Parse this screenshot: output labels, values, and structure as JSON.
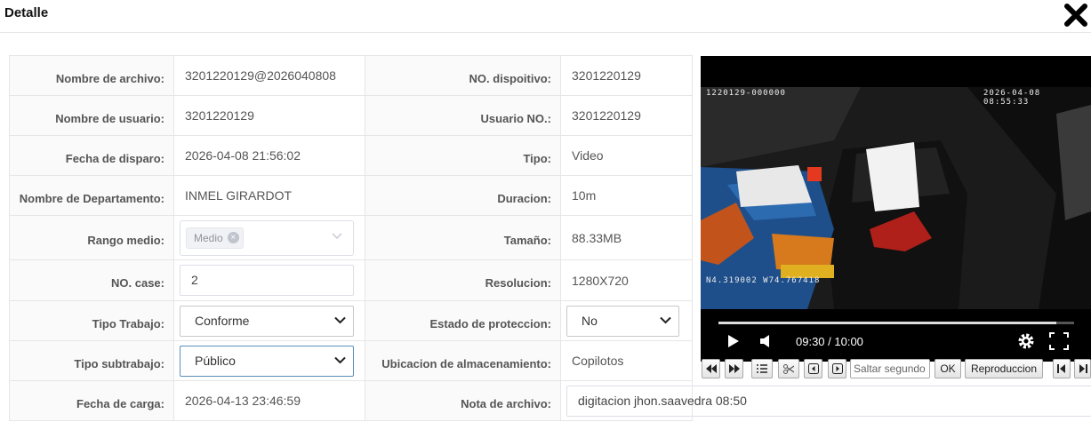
{
  "header": {
    "title": "Detalle"
  },
  "fields": {
    "nombre_archivo": {
      "label": "Nombre de archivo:",
      "value": "3201220129@2026040808"
    },
    "nombre_usuario": {
      "label": "Nombre de usuario:",
      "value": "3201220129"
    },
    "fecha_disparo": {
      "label": "Fecha de disparo:",
      "value": "2026-04-08 21:56:02"
    },
    "departamento": {
      "label": "Nombre de Departamento:",
      "value": "INMEL GIRARDOT"
    },
    "rango_medio": {
      "label": "Rango medio:",
      "value": "Medio"
    },
    "no_case": {
      "label": "NO. case:",
      "value": "2"
    },
    "tipo_trabajo": {
      "label": "Tipo Trabajo:",
      "value": "Conforme"
    },
    "tipo_subtrabajo": {
      "label": "Tipo subtrabajo:",
      "value": "Público"
    },
    "fecha_carga": {
      "label": "Fecha de carga:",
      "value": "2026-04-13 23:46:59"
    },
    "no_dispositivo": {
      "label": "NO. dispoitivo:",
      "value": "3201220129"
    },
    "usuario_no": {
      "label": "Usuario NO.:",
      "value": "3201220129"
    },
    "tipo": {
      "label": "Tipo:",
      "value": "Video"
    },
    "duracion": {
      "label": "Duracion:",
      "value": "10m"
    },
    "tamano": {
      "label": "Tamaño:",
      "value": "88.33MB"
    },
    "resolucion": {
      "label": "Resolucion:",
      "value": "1280X720"
    },
    "estado_proteccion": {
      "label": "Estado de proteccion:",
      "value": "No"
    },
    "ubicacion": {
      "label": "Ubicacion de almacenamiento:",
      "value": "Copilotos"
    },
    "nota_archivo": {
      "label": "Nota de archivo:",
      "value": "digitacion jhon.saavedra 08:50"
    }
  },
  "video": {
    "osd_top_left": "1220129-000000",
    "osd_top_right": "2026-04-08 08:55:33",
    "osd_bottom_left": "N4.319002 W74.767418",
    "time": "09:30 / 10:00",
    "progress": 0.95
  },
  "toolbar": {
    "seek_placeholder": "Saltar segundo",
    "ok_label": "OK",
    "playback_label": "Reproduccion"
  },
  "colors": {
    "video_bg": "#000000",
    "focus_border": "#5b8fb9"
  }
}
